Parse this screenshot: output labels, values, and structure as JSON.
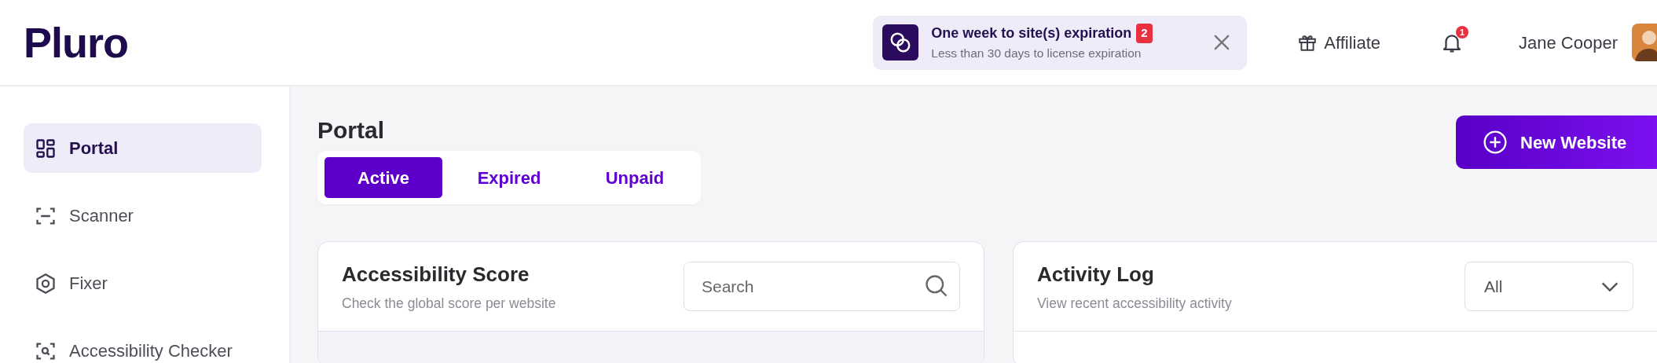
{
  "logo": {
    "text": "Pluro"
  },
  "notification": {
    "title": "One week to site(s) expiration",
    "count": "2",
    "subtitle": "Less than 30 days to license expiration"
  },
  "header": {
    "affiliate": "Affiliate",
    "notifications_count": "1",
    "user_name": "Jane Cooper"
  },
  "sidebar": {
    "items": [
      {
        "label": "Portal",
        "kind": "grid",
        "selected": true
      },
      {
        "label": "Scanner",
        "kind": "scan",
        "selected": false
      },
      {
        "label": "Fixer",
        "kind": "hexagon",
        "selected": false
      },
      {
        "label": "Accessibility Checker",
        "kind": "scan-search",
        "selected": false
      }
    ]
  },
  "page": {
    "title": "Portal",
    "new_button": "New Website",
    "tabs": [
      {
        "label": "Active",
        "selected": true
      },
      {
        "label": "Expired",
        "selected": false
      },
      {
        "label": "Unpaid",
        "selected": false
      }
    ]
  },
  "cards": [
    {
      "title": "Accessibility Score",
      "subtitle": "Check the global score per website",
      "control": {
        "kind": "search",
        "placeholder": "Search"
      }
    },
    {
      "title": "Activity Log",
      "subtitle": "View recent accessibility activity",
      "control": {
        "kind": "select",
        "value": "All"
      }
    }
  ]
}
